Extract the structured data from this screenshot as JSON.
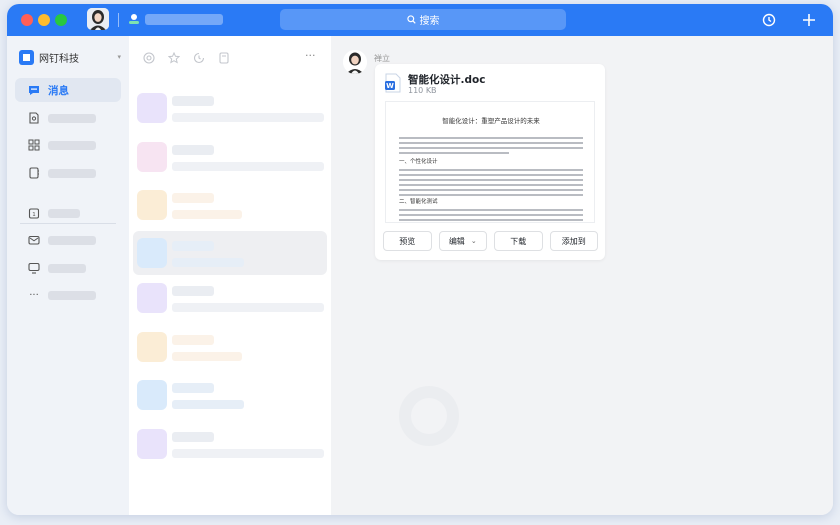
{
  "titlebar": {
    "search_placeholder": "搜索",
    "icons": [
      "clock-icon",
      "plus-icon"
    ]
  },
  "sidebar": {
    "org_name": "网钉科技",
    "active_item": "消息"
  },
  "chat": {
    "sender_name": "禅立",
    "file": {
      "name": "智能化设计.doc",
      "size": "110 KB",
      "type_letter": "W",
      "preview_title": "智能化设计：重塑产品设计的未来",
      "preview_heading_1": "一、个性化设计",
      "preview_heading_2": "二、智能化测试"
    },
    "actions": {
      "preview": "预览",
      "edit": "编辑",
      "download": "下载",
      "add_to": "添加到"
    }
  },
  "colors": {
    "brand_blue": "#2a7af5",
    "avatar_colors": [
      "#e9e3fb",
      "#f7e4f2",
      "#fbedd6",
      "#d9eafb",
      "#e9e3fb",
      "#fbedd6",
      "#d9eafb",
      "#e9e3fb"
    ]
  }
}
